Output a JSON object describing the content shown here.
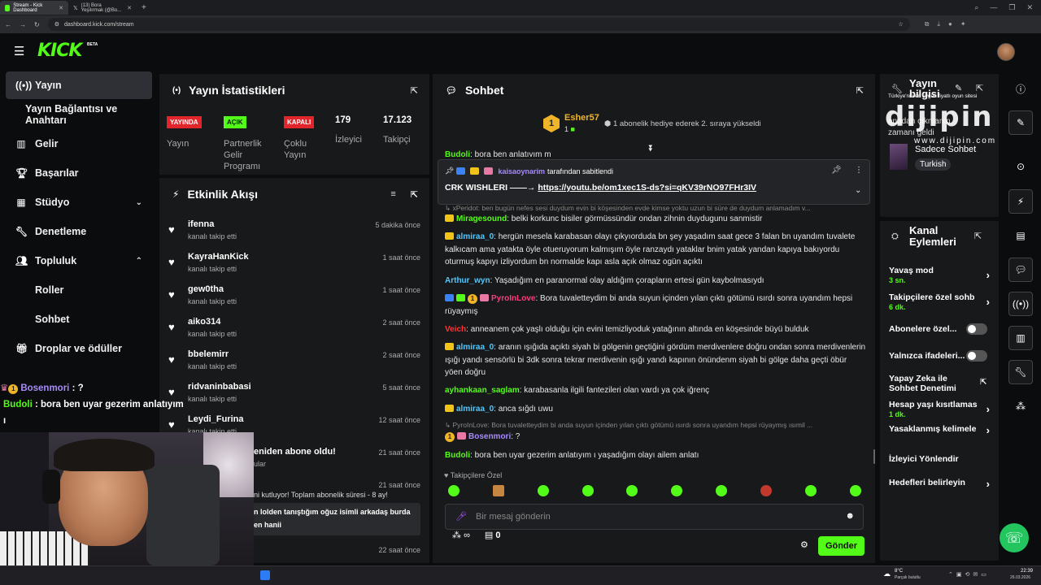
{
  "browser": {
    "tabs": [
      {
        "title": "Stream - Kick Dashboard"
      },
      {
        "title": "(13) Bora Yeşilırmak (@Bo..."
      }
    ],
    "url": "dashboard.kick.com/stream"
  },
  "header": {
    "logo": "KICK",
    "beta": "BETA"
  },
  "sidebar": {
    "items": [
      {
        "label": "Yayın",
        "icon": "broadcast-icon"
      },
      {
        "label": "Yayın Bağlantısı ve Anahtarı"
      },
      {
        "label": "Gelir",
        "icon": "chart-icon"
      },
      {
        "label": "Başarılar",
        "icon": "trophy-icon"
      },
      {
        "label": "Stüdyo",
        "icon": "studio-icon"
      },
      {
        "label": "Denetleme",
        "icon": "wrench-icon"
      },
      {
        "label": "Topluluk",
        "icon": "community-icon"
      },
      {
        "label": "Roller"
      },
      {
        "label": "Sohbet"
      },
      {
        "label": "Droplar ve ödüller",
        "icon": "gift-icon"
      }
    ]
  },
  "stats": {
    "title": "Yayın İstatistikleri",
    "badges": {
      "live": "YAYINDA",
      "partner": "AÇIK",
      "multi": "KAPALI"
    },
    "labels": {
      "live": "Yayın",
      "partner": "Partnerlik Gelir Programı",
      "multi": "Çoklu Yayın",
      "viewers": "İzleyici",
      "followers": "Takipçi"
    },
    "viewers": "179",
    "followers": "17.123"
  },
  "activity": {
    "title": "Etkinlik Akışı",
    "items": [
      {
        "name": "ifenna",
        "sub": "kanalı takip etti",
        "time": "5 dakika önce"
      },
      {
        "name": "KayraHanKick",
        "sub": "kanalı takip etti",
        "time": "1 saat önce"
      },
      {
        "name": "gew0tha",
        "sub": "kanalı takip etti",
        "time": "1 saat önce"
      },
      {
        "name": "aiko314",
        "sub": "kanalı takip etti",
        "time": "2 saat önce"
      },
      {
        "name": "bbelemirr",
        "sub": "kanalı takip etti",
        "time": "2 saat önce"
      },
      {
        "name": "ridvaninbabasi",
        "sub": "kanalı takip etti",
        "time": "5 saat önce"
      },
      {
        "name": "Leydi_Furina",
        "sub": "kanalı takip etti",
        "time": "12 saat önce"
      },
      {
        "name": "eniden abone oldu!",
        "sub": "ular",
        "time": "21 saat önce"
      },
      {
        "name": "ni kutluyor! Toplam abonelik süresi - 8 ay!",
        "sub": "",
        "time": "21 saat önce"
      },
      {
        "name": "n lolden tanıştığım oğuz isimli arkadaş burda",
        "sub": "en hanii",
        "time": ""
      },
      {
        "name": "",
        "sub": "",
        "time": "22 saat önce"
      }
    ]
  },
  "chat": {
    "title": "Sohbet",
    "leader": {
      "name": "Esher57",
      "count": "1",
      "rank": "1",
      "msg": "1 abonelik hediye ederek 2. sıraya yükseldi"
    },
    "top_msg": {
      "user": "Budoli",
      "text": ": bora ben anlatıyım m"
    },
    "pinned": {
      "by": "kaisaoynarim",
      "by_suffix": "tarafından sabitlendi",
      "text": "CRK WISHLERI ——→",
      "link": "https://youtu.be/om1xec1S-ds?si=qKV39rNO97FHr3IV"
    },
    "reply1": "xPeridot: ben bugün nefes sesi duydum evin bi köşesinden evde kimse yoktu uzun bi süre de duydum anlamadım v...",
    "messages": [
      {
        "user": "Miragesound",
        "text": ": belki korkunc bisiler görmüssündür ondan zihnin duydugunu sanmistir",
        "color": "#53fc18"
      },
      {
        "user": "almiraa_0",
        "text": ": hergün mesela karabasan olayı çıkyıorduda bn şey yaşadım saat gece 3 falan bn uyandım tuvalete kalkıcam ama yatakta öyle otueruyorum kalmışım öyle ranzaydı yataklar bnim yatak yandan kapıya bakıyordu oturmuş kapıyı izliyordum bn normalde kapı asla açık olmaz ogün açıktı",
        "color": "#53c8fc"
      },
      {
        "user": "Arthur_wyn",
        "text": ": Yaşadığım en paranormal olay aldığım çorapların ertesi gün kaybolmasıydı",
        "color": "#53c8fc"
      },
      {
        "user": "PyroInLove",
        "text": ": Bora tuvaletteydim bi anda suyun içinden yılan çıktı götümü ısırdı sonra uyandım hepsi rüyaymış",
        "color": "#ff3b7a"
      },
      {
        "user": "Veich",
        "text": ": anneanem çok yaşlı olduğu için evini temizliyoduk yatağının altında en köşesinde büyü bulduk",
        "color": "#ff3333"
      },
      {
        "user": "almiraa_0",
        "text": ": aranın ışığıda açıktı siyah bi gölgenin geçtiğini gördüm merdivenlere doğru ondan sonra merdivenlerin ışığı yandı sensörlü bi 3dk sonra tekrar merdivenin ışığı yandı kapının önündenm siyah bi gölge daha geçti öbür yöen doğru",
        "color": "#53c8fc"
      },
      {
        "user": "ayhankaan_saglam",
        "text": ": karabasanla ilgili fantezileri olan vardı ya çok iğrenç",
        "color": "#53fc18"
      },
      {
        "user": "almiraa_0",
        "text": ": anca sığdı uwu",
        "color": "#53c8fc"
      }
    ],
    "reply2": "PyroInLove: Bora tuvaletteydim bi anda suyun içinden yılan çıktı götümü ısırdı sonra uyandım hepsi rüyaymış ısımil ...",
    "bosen": {
      "user": "Bosenmori",
      "text": ": ?"
    },
    "last": {
      "user": "Budoli",
      "text": ": bora ben uyar gezerim anlatıyım ı yaşadığım olayı ailem anlatı"
    },
    "followers_only": "Takipçilere Özel",
    "placeholder": "Bir mesaj gönderin",
    "infinity": "∞",
    "count": "0",
    "send": "Gönder"
  },
  "info": {
    "title": "Yayın bilgisi",
    "subtitle": "Türkiye'nin en uygun fiyatlı oyun sitesi",
    "desc_partial": "anadan çıkmanın zamanı geldi",
    "stream_title": "Sadece Sohbet",
    "tag": "Turkish"
  },
  "watermark": {
    "text": "dijipin",
    "url": "www.dijipin.com"
  },
  "actions": {
    "title": "Kanal Eylemleri",
    "items": [
      {
        "label": "Yavaş mod",
        "value": "3 sn."
      },
      {
        "label": "Takipçilere özel sohb",
        "value": "6 dk."
      },
      {
        "label": "Abonelere özel..."
      },
      {
        "label": "Yalnızca ifadeleri..."
      },
      {
        "label": "Yapay Zeka ile Sohbet Denetimi"
      },
      {
        "label": "Hesap yaşı kısıtlamas",
        "value": "1 dk."
      },
      {
        "label": "Yasaklanmış kelimele"
      },
      {
        "label": "İzleyici Yönlendir"
      },
      {
        "label": "Hedefleri belirleyin"
      }
    ]
  },
  "overlay": {
    "line1_user": "Bosenmori",
    "line1_text": " : ?",
    "line2_user": "Budoli",
    "line2_text": " : bora ben uyar gezerim anlatıyım ı",
    "line3": "yaşadığım olayı ailem anlatı"
  },
  "taskbar": {
    "weather": "8°C",
    "weather_desc": "Parçalı bulutlu",
    "time": "22:39",
    "date": "26.03.2026"
  },
  "colors": {
    "accent": "#53fc18",
    "live": "#e0262b",
    "bg": "#0b0c0e",
    "panel": "#18191b"
  }
}
